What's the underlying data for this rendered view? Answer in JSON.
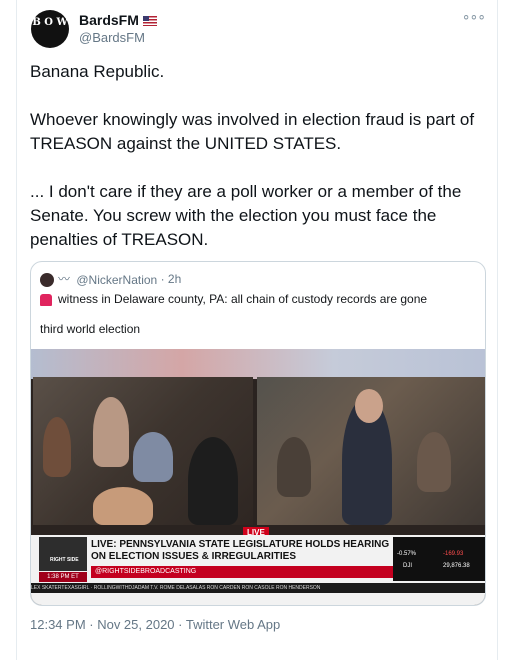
{
  "author": {
    "display_name": "BardsFM",
    "handle": "@BardsFM",
    "avatar_text": "B O W"
  },
  "tweet": {
    "paragraphs": [
      "Banana Republic.",
      "Whoever knowingly was involved in election fraud is part of TREASON against the UNITED STATES.",
      "... I don't care if they are a poll worker or a member of the Senate. You screw with the election you must face the penalties of TREASON."
    ]
  },
  "quoted": {
    "handle": "@NickerNation",
    "age": "2h",
    "text1": "witness in Delaware county, PA: all chain of custody records are gone",
    "text2": "third world election",
    "video": {
      "live_label": "LIVE",
      "headline": "LIVE: PENNSYLVANIA STATE LEGISLATURE HOLDS HEARING ON ELECTION ISSUES & IRREGULARITIES",
      "subline": "@RIGHTSIDEBROADCASTING",
      "time": "1:38 PM ET",
      "logo": "RIGHT SIDE",
      "ticker_a": "-0.57%",
      "ticker_b": "-169.93",
      "ticker_c": "DJI",
      "ticker_d": "29,876.38",
      "crawl": "LEX SKATERTEXASGIRL · ROLLINGWITHDJADAM T.V. ROME DELASALAS RON CARDEN RON CASOLE RON HENDERSON"
    }
  },
  "meta": {
    "timestamp": "12:34 PM · Nov 25, 2020 · Twitter Web App"
  },
  "colors": {
    "accent": "#1da1f2",
    "muted": "#657786",
    "live_red": "#d0021b"
  }
}
